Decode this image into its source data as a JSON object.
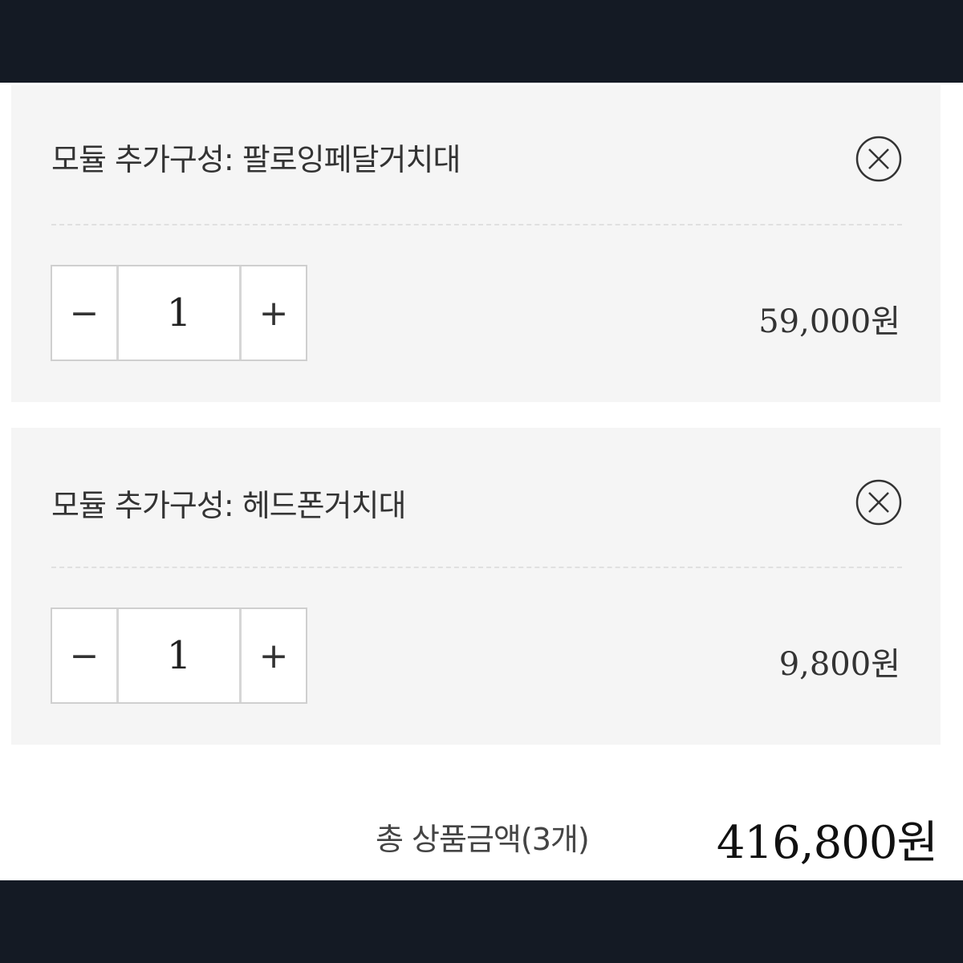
{
  "options": [
    {
      "title": "모듈 추가구성: 팔로잉페달거치대",
      "decrement_symbol": "−",
      "quantity": "1",
      "increment_symbol": "+",
      "price": "59,000원"
    },
    {
      "title": "모듈 추가구성: 헤드폰거치대",
      "decrement_symbol": "−",
      "quantity": "1",
      "increment_symbol": "+",
      "price": "9,800원"
    }
  ],
  "summary": {
    "total_label": "총 상품금액(3개)",
    "total_value": "416,800원"
  },
  "icons": {
    "remove": "close-circle-icon"
  },
  "colors": {
    "top_bar": "#141a24",
    "card_background": "#f5f5f5"
  }
}
